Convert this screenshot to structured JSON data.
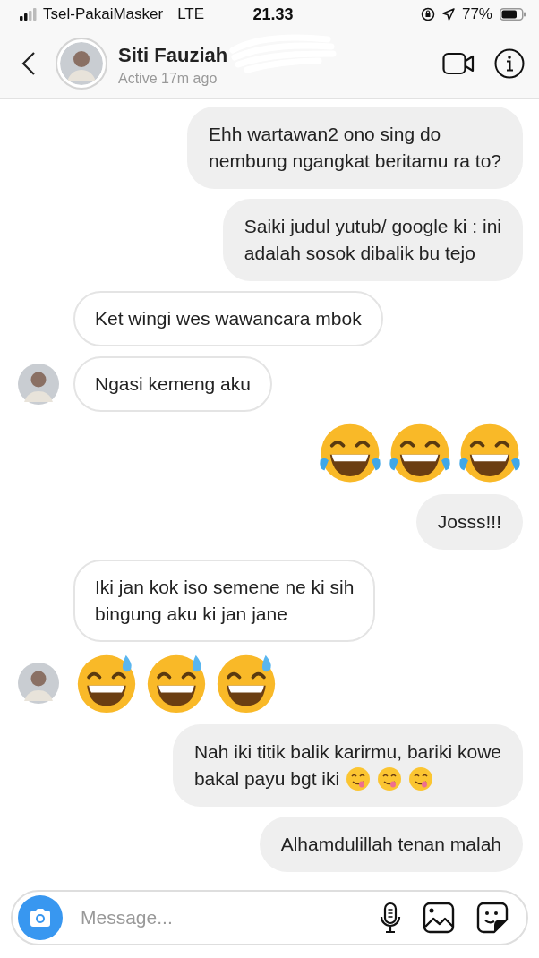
{
  "status_bar": {
    "carrier": "Tsel-PakaiMasker",
    "network": "LTE",
    "time": "21.33",
    "battery": "77%"
  },
  "header": {
    "name": "Siti Fauziah",
    "status": "Active 17m ago"
  },
  "messages": [
    {
      "kind": "text",
      "outgoing": true,
      "lines": [
        "Ehh wartawan2 ono sing do",
        "nembung ngangkat beritamu ra to?"
      ]
    },
    {
      "kind": "text",
      "outgoing": true,
      "lines": [
        "Saiki judul yutub/ google ki : ini",
        "adalah sosok dibalik bu tejo"
      ]
    },
    {
      "kind": "text",
      "outgoing": false,
      "show_avatar": false,
      "lines": [
        "Ket wingi wes wawancara mbok"
      ]
    },
    {
      "kind": "text",
      "outgoing": false,
      "show_avatar": true,
      "lines": [
        "Ngasi kemeng aku"
      ]
    },
    {
      "kind": "emoji",
      "outgoing": true,
      "icons": [
        {
          "kind": "laugh-cry"
        },
        {
          "kind": "laugh-cry"
        },
        {
          "kind": "laugh-cry"
        }
      ]
    },
    {
      "kind": "text",
      "outgoing": true,
      "lines": [
        "Josss!!!"
      ]
    },
    {
      "kind": "text",
      "outgoing": false,
      "show_avatar": false,
      "lines": [
        "Iki jan kok iso semene ne ki sih",
        "bingung aku ki jan jane"
      ]
    },
    {
      "kind": "emoji",
      "outgoing": false,
      "show_avatar": true,
      "icons": [
        {
          "kind": "sweat-smile"
        },
        {
          "kind": "sweat-smile"
        },
        {
          "kind": "sweat-smile"
        }
      ]
    },
    {
      "kind": "text",
      "outgoing": true,
      "lines": [
        "Nah iki titik balik karirmu, bariki kowe",
        "bakal payu bgt iki"
      ],
      "trailing_icons": [
        {
          "kind": "yum"
        },
        {
          "kind": "yum"
        },
        {
          "kind": "yum"
        }
      ]
    },
    {
      "kind": "text",
      "outgoing": true,
      "lines": [
        "Alhamdulillah tenan malah"
      ]
    }
  ],
  "composer": {
    "placeholder": "Message..."
  }
}
